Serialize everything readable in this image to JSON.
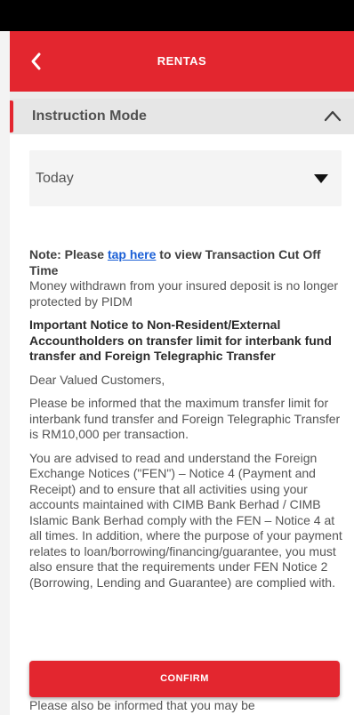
{
  "header": {
    "title": "RENTAS"
  },
  "section": {
    "title": "Instruction Mode"
  },
  "dropdown": {
    "selected": "Today"
  },
  "notes": {
    "cutoff_prefix": "Note: Please ",
    "cutoff_link": "tap here",
    "cutoff_suffix": " to view Transaction Cut Off Time",
    "pidm": "Money withdrawn from your insured deposit is no longer protected by PIDM",
    "notice_title": "Important Notice to Non-Resident/External Accountholders on transfer limit for interbank fund transfer and Foreign Telegraphic Transfer",
    "greeting": "Dear Valued Customers,",
    "limit_paragraph": "Please be informed that the maximum transfer limit for interbank fund transfer and Foreign Telegraphic Transfer is RM10,000 per transaction.",
    "fen_paragraph": "You are advised to read and understand the Foreign Exchange Notices (\"FEN\") – Notice 4 (Payment and Receipt) and to ensure that all activities using your accounts maintained with CIMB Bank Berhad / CIMB Islamic Bank Berhad comply with the FEN – Notice 4 at all times. In addition, where the purpose of your payment relates to loan/borrowing/financing/guarantee, you must also ensure that the requirements under FEN Notice 2 (Borrowing, Lending and Guarantee) are complied with.",
    "bottom_line": "Please also be informed that you may be"
  },
  "actions": {
    "confirm_label": "CONFIRM"
  },
  "colors": {
    "brand_red": "#e3262f",
    "link_blue": "#1a5fd6"
  },
  "icons": {
    "back": "back-icon",
    "collapse": "chevron-up-icon",
    "dropdown": "caret-down-icon"
  }
}
